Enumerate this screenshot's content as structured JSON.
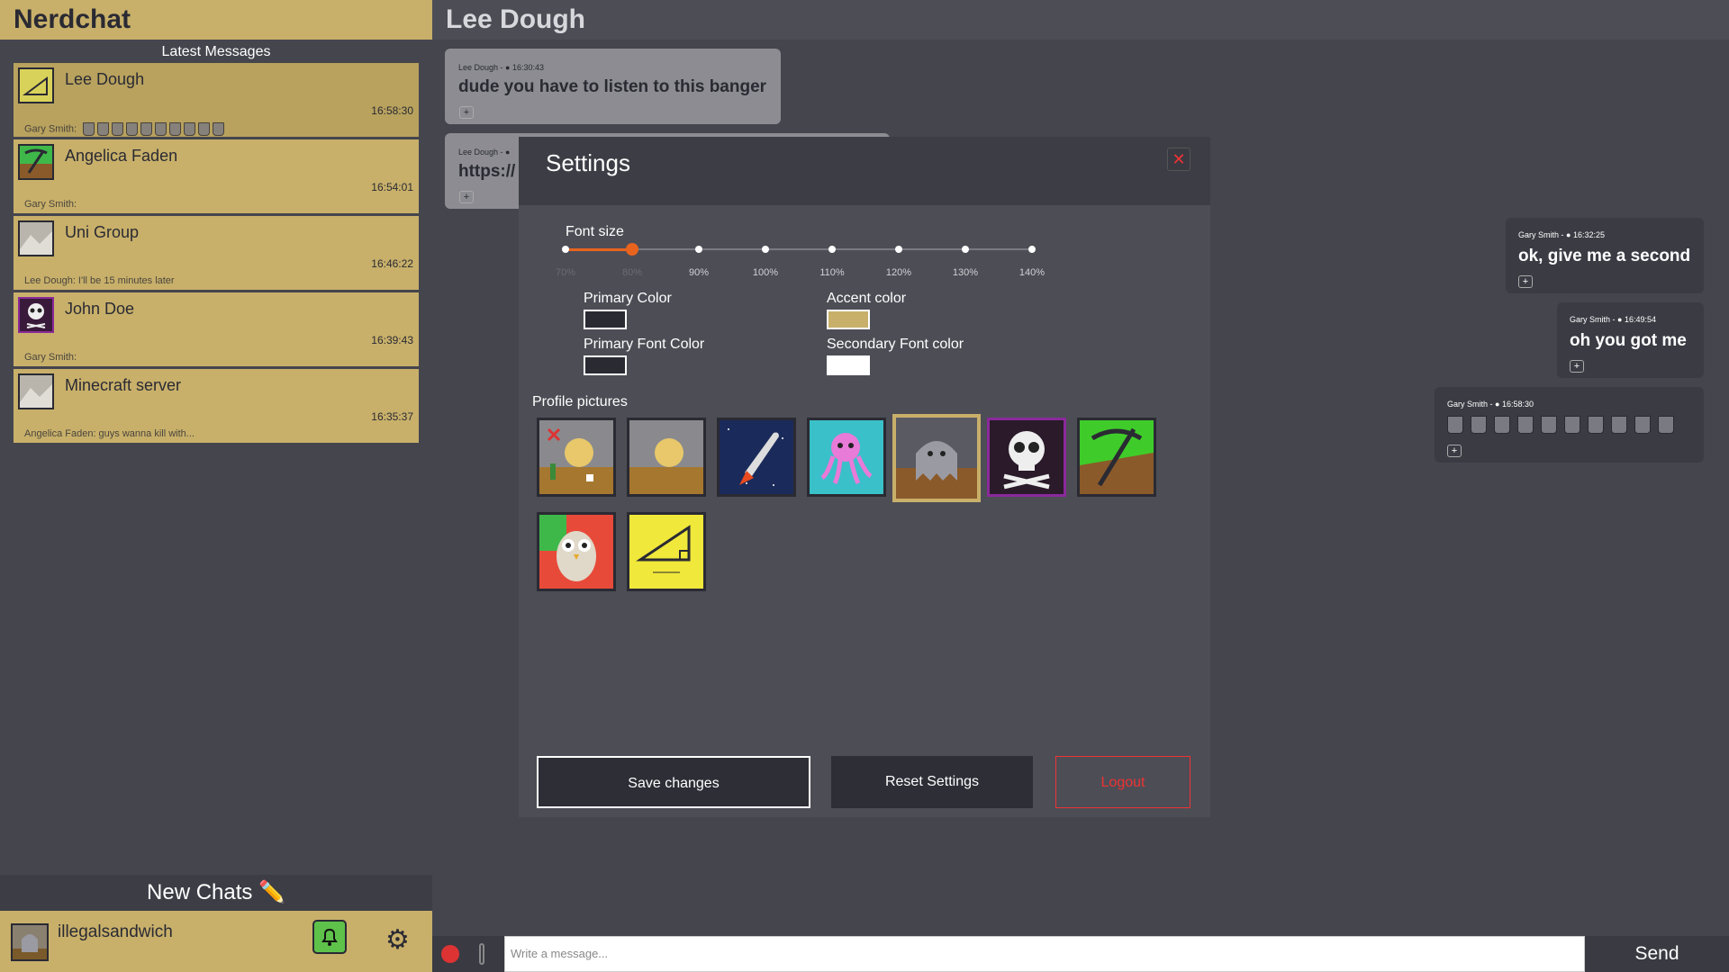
{
  "sidebar": {
    "brand": "Nerdchat",
    "latest_label": "Latest Messages",
    "chats": [
      {
        "name": "Lee Dough",
        "time": "16:58:30",
        "preview": "Gary Smith:",
        "avatar": "triangle-math-icon"
      },
      {
        "name": "Angelica Faden",
        "time": "16:54:01",
        "preview": "Gary Smith:",
        "avatar": "pickaxe-icon"
      },
      {
        "name": "Uni Group",
        "time": "16:46:22",
        "preview": "Lee Dough: I'll be 15 minutes later",
        "avatar": "default-landscape-icon"
      },
      {
        "name": "John Doe",
        "time": "16:39:43",
        "preview": "Gary Smith:",
        "avatar": "skull-icon"
      },
      {
        "name": "Minecraft server",
        "time": "16:35:37",
        "preview": "Angelica Faden: guys wanna kill with...",
        "avatar": "default-landscape-icon"
      }
    ],
    "new_chats": "New Chats ✏️",
    "username": "illegalsandwich"
  },
  "header": {
    "title": "Lee Dough"
  },
  "messages": {
    "left": [
      {
        "meta": "Lee Dough - ● 16:30:43",
        "text": "dude you have to listen to this banger"
      },
      {
        "meta": "Lee Dough - ●",
        "text": "https://"
      }
    ],
    "right": [
      {
        "meta": "Gary Smith - ● 16:32:25",
        "text": "ok, give me a second"
      },
      {
        "meta": "Gary Smith - ● 16:49:54",
        "text": "oh you got me"
      },
      {
        "meta": "Gary Smith - ● 16:58:30",
        "text": ""
      }
    ]
  },
  "settings": {
    "title": "Settings",
    "close": "✕",
    "font_size_label": "Font size",
    "font_sizes": [
      "70%",
      "80%",
      "90%",
      "100%",
      "110%",
      "120%",
      "130%",
      "140%"
    ],
    "font_size_selected": "80%",
    "primary_color_label": "Primary Color",
    "accent_color_label": "Accent color",
    "primary_font_color_label": "Primary Font Color",
    "secondary_font_color_label": "Secondary Font color",
    "colors": {
      "primary": "#2a2a33",
      "accent": "#c8b06a",
      "primary_font": "#2a2a33",
      "secondary_font": "#ffffff"
    },
    "profile_pictures_label": "Profile pictures",
    "profile_pictures": [
      "moon-cactus-icon",
      "moon-landscape-icon",
      "rocket-icon",
      "octopus-icon",
      "ghost-icon",
      "skull-icon",
      "pickaxe-icon",
      "owl-icon",
      "triangle-math-icon"
    ],
    "selected_picture": "ghost-icon",
    "save_label": "Save changes",
    "reset_label": "Reset Settings",
    "logout_label": "Logout"
  },
  "composer": {
    "placeholder": "Write a message...",
    "send_label": "Send"
  }
}
